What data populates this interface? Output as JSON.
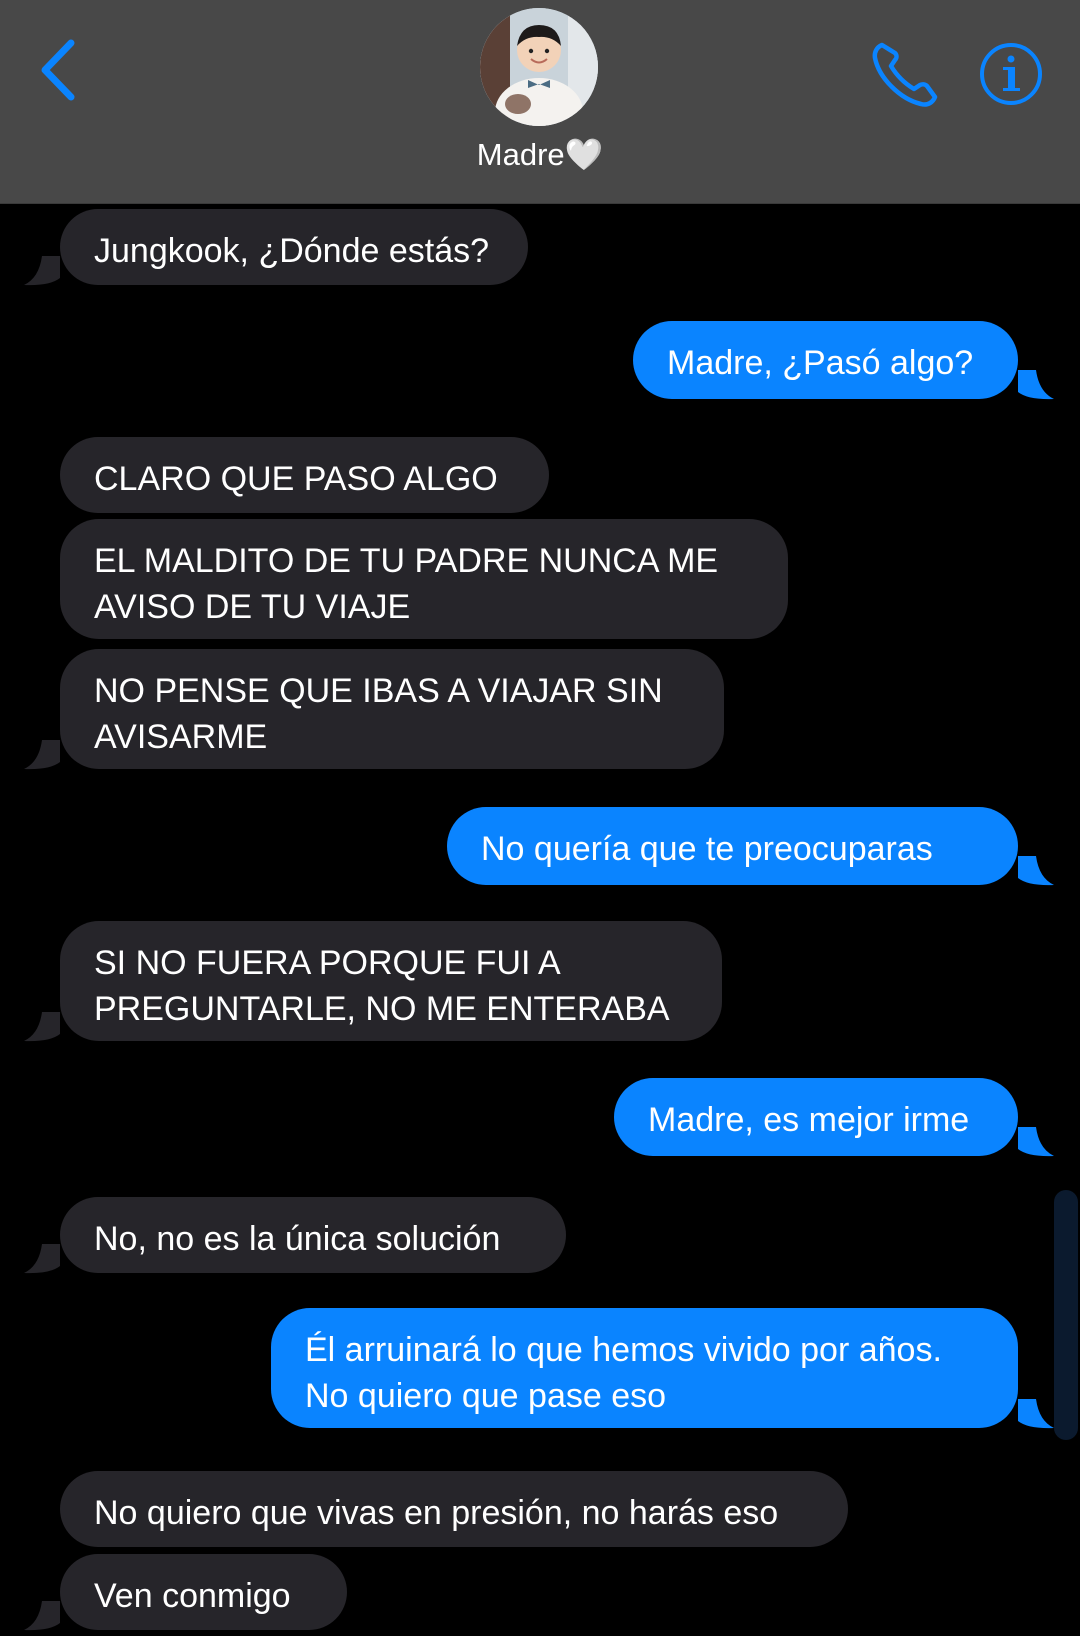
{
  "header": {
    "contact_name": "Madre🤍",
    "back_icon": "chevron-left-icon",
    "call_icon": "phone-icon",
    "info_icon": "info-icon",
    "accent_color": "#0a84ff"
  },
  "messages": [
    {
      "direction": "incoming",
      "text": "Jungkook, ¿Dónde estás?"
    },
    {
      "direction": "outgoing",
      "text": "Madre, ¿Pasó algo?"
    },
    {
      "direction": "incoming",
      "text": "CLARO QUE PASO ALGO"
    },
    {
      "direction": "incoming",
      "text": "EL MALDITO DE TU PADRE NUNCA ME\nAVISO DE TU VIAJE"
    },
    {
      "direction": "incoming",
      "text": "NO PENSE QUE IBAS A VIAJAR SIN\nAVISARME"
    },
    {
      "direction": "outgoing",
      "text": "No quería que te preocuparas"
    },
    {
      "direction": "incoming",
      "text": "SI NO FUERA PORQUE FUI A\nPREGUNTARLE, NO ME ENTERABA"
    },
    {
      "direction": "outgoing",
      "text": "Madre, es mejor irme"
    },
    {
      "direction": "incoming",
      "text": "No, no es la única solución"
    },
    {
      "direction": "outgoing",
      "text": "Él arruinará lo que hemos vivido por años.\nNo quiero que pase eso"
    },
    {
      "direction": "incoming",
      "text": "No quiero que vivas en presión, no harás eso"
    },
    {
      "direction": "incoming",
      "text": "Ven conmigo"
    }
  ]
}
